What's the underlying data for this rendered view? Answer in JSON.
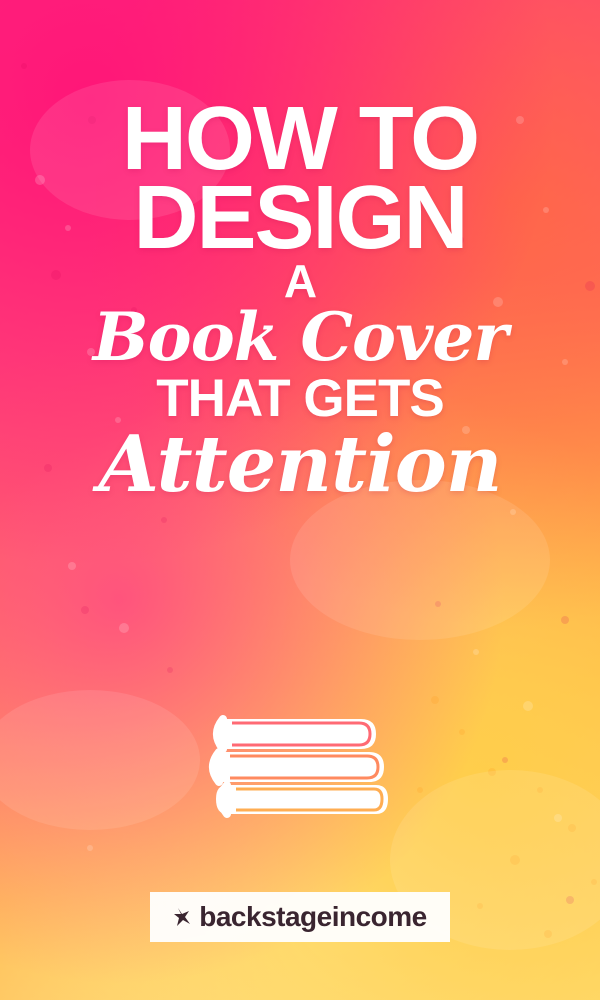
{
  "headline": {
    "line1": "HOW TO",
    "line2": "DESIGN",
    "line3": "A",
    "line4": "Book Cover",
    "line5": "THAT GETS",
    "line6": "Attention"
  },
  "icon": {
    "name": "stacked-books-icon"
  },
  "brand": {
    "logo_text": "backstageincome"
  },
  "colors": {
    "top_pink": "#ff2f7f",
    "mid_coral": "#ff7a55",
    "bottom_gold": "#ffd66a",
    "text": "#ffffff",
    "logo_text": "#3a2530"
  }
}
